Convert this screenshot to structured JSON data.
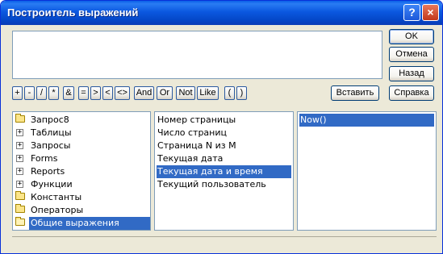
{
  "window": {
    "title": "Построитель выражений"
  },
  "titlebar": {
    "help_glyph": "?",
    "close_glyph": "×"
  },
  "buttons": {
    "ok": "OK",
    "cancel": "Отмена",
    "back": "Назад",
    "paste": "Вставить",
    "help": "Справка"
  },
  "operators": [
    "+",
    "-",
    "/",
    "*",
    "&",
    "=",
    ">",
    "<",
    "<>",
    "And",
    "Or",
    "Not",
    "Like",
    "(",
    ")"
  ],
  "tree": {
    "items": [
      {
        "label": "Запрос8",
        "icon": "folder-icon",
        "expand": false
      },
      {
        "label": "Таблицы",
        "icon": "folder-icon",
        "expand": true
      },
      {
        "label": "Запросы",
        "icon": "folder-icon",
        "expand": true
      },
      {
        "label": "Forms",
        "icon": "folder-icon",
        "expand": true
      },
      {
        "label": "Reports",
        "icon": "folder-icon",
        "expand": true
      },
      {
        "label": "Функции",
        "icon": "folder-icon",
        "expand": true
      },
      {
        "label": "Константы",
        "icon": "folder-icon",
        "expand": false
      },
      {
        "label": "Операторы",
        "icon": "folder-icon",
        "expand": false
      },
      {
        "label": "Общие выражения",
        "icon": "open-folder-icon",
        "expand": false,
        "selected": true
      }
    ]
  },
  "middle_list": {
    "items": [
      {
        "label": "Номер страницы"
      },
      {
        "label": "Число страниц"
      },
      {
        "label": "Страница N из M"
      },
      {
        "label": "Текущая дата"
      },
      {
        "label": "Текущая дата и время",
        "selected": true
      },
      {
        "label": "Текущий пользователь"
      }
    ]
  },
  "right_list": {
    "items": [
      {
        "label": "Now()",
        "selected": true
      }
    ]
  },
  "colors": {
    "selection": "#316ac5",
    "titlebar": "#0b58e0",
    "dialog": "#ece9d8"
  }
}
